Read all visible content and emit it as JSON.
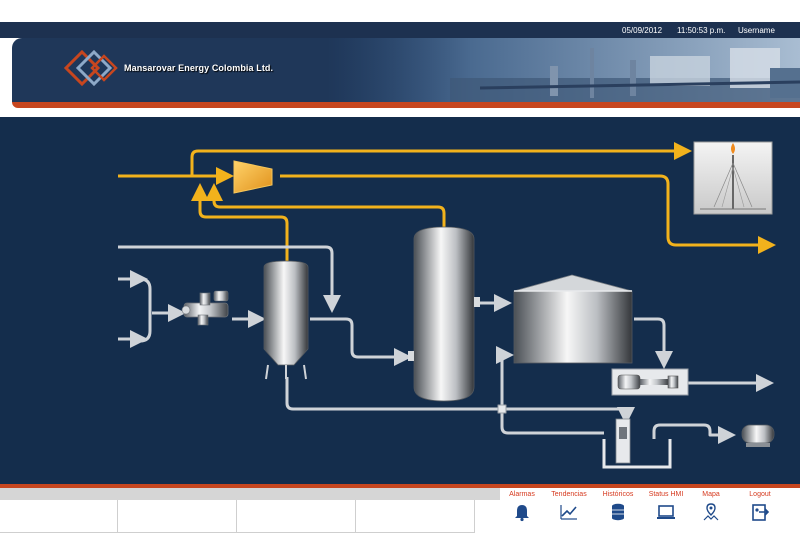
{
  "header": {
    "date": "05/09/2012",
    "time": "11:50:53 p.m.",
    "user": "Username",
    "company": "Mansarovar Energy Colombia Ltd."
  },
  "nav": [
    {
      "id": "alarmas",
      "label": "Alarmas",
      "icon": "bell-icon"
    },
    {
      "id": "tendencias",
      "label": "Tendencias",
      "icon": "trend-chart-icon"
    },
    {
      "id": "historicos",
      "label": "Históricos",
      "icon": "database-icon"
    },
    {
      "id": "status",
      "label": "Status HMI",
      "icon": "monitor-icon"
    },
    {
      "id": "mapa",
      "label": "Mapa",
      "icon": "map-icon"
    },
    {
      "id": "logout",
      "label": "Logout",
      "icon": "logout-icon"
    }
  ],
  "colors": {
    "accent": "#c7461f",
    "process_bg": "#142d4c",
    "gas_line": "#f2b21c",
    "liquid_line": "#cfd3d8",
    "nav_label": "#d63a1f"
  }
}
